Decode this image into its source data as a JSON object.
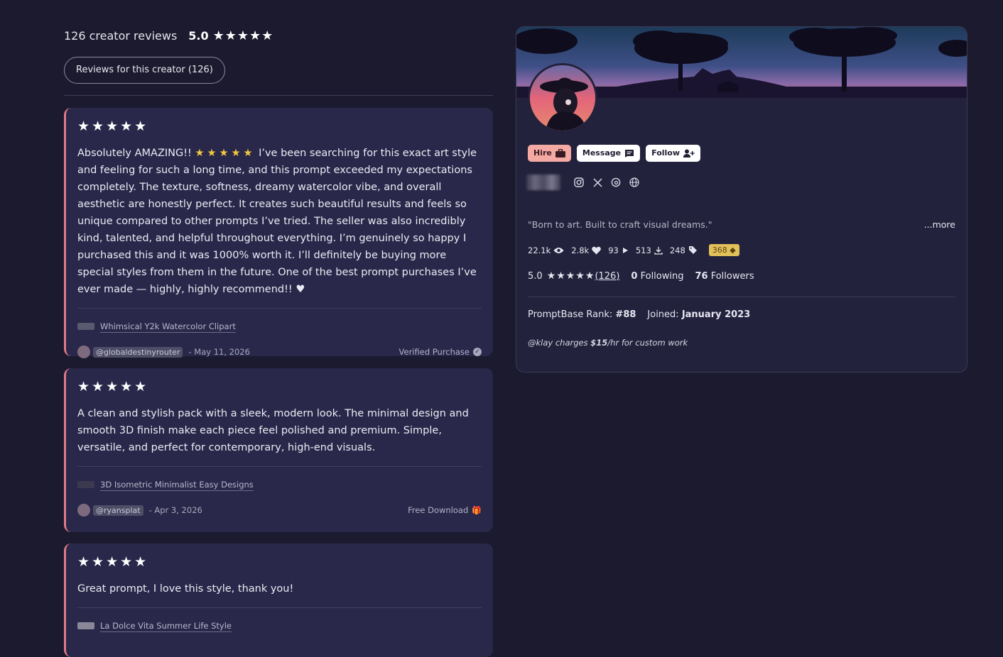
{
  "reviews_header": {
    "count_text": "126 creator reviews",
    "score": "5.0",
    "stars": "★★★★★",
    "filter_button": "Reviews for this creator (126)"
  },
  "reviews": [
    {
      "stars": "★★★★★",
      "text_a": "Absolutely AMAZING!! ",
      "inline_stars": "★★★★★",
      "text_b": " I’ve been searching for this exact art style and feeling for such a long time, and this prompt exceeded my expectations completely. The texture, softness, dreamy watercolor vibe, and overall aesthetic are honestly perfect. It creates such beautiful results and feels so unique compared to other prompts I’ve tried. The seller was also incredibly kind, talented, and helpful throughout everything. I’m genuinely so happy I purchased this and it was 1000% worth it. I’ll definitely be buying more special styles from them in the future. One of the best prompt purchases I’ve ever made — highly, highly recommend!! ♥",
      "product": "Whimsical Y2k Watercolor Clipart",
      "handle": "@globaldestinyrouter",
      "date": "- May 11, 2026",
      "badge": "Verified Purchase",
      "badge_icon": "✓"
    },
    {
      "stars": "★★★★★",
      "text": "A clean and stylish pack with a sleek, modern look. The minimal design and smooth 3D finish make each piece feel polished and premium. Simple, versatile, and perfect for contemporary, high-end visuals.",
      "product": "3D Isometric Minimalist Easy Designs",
      "handle": "@ryansplat",
      "date": "- Apr 3, 2026",
      "badge": "Free Download",
      "badge_icon": "🎁"
    },
    {
      "stars": "★★★★★",
      "text": "Great prompt, I love this style, thank you!",
      "product": "La Dolce Vita Summer Life Style"
    }
  ],
  "profile": {
    "hire": "Hire",
    "message": "Message",
    "follow": "Follow",
    "bio": "\"Born to art. Built to craft visual dreams.\"",
    "more": "...more",
    "stats": {
      "views": "22.1k",
      "likes": "2.8k",
      "runs": "93",
      "downloads": "513",
      "prompts": "248",
      "badge": "368 ◆"
    },
    "rating": "5.0",
    "rating_stars": "★★★★★",
    "rating_count": "(126)",
    "following_num": "0",
    "following_label": " Following",
    "followers_num": "76",
    "followers_label": " Followers",
    "rank_label": "PromptBase Rank: ",
    "rank": "#88",
    "joined_label": "Joined: ",
    "joined": "January 2023",
    "charges_a": "@klay charges ",
    "charges_rate": "$15",
    "charges_b": "/hr for custom work"
  }
}
